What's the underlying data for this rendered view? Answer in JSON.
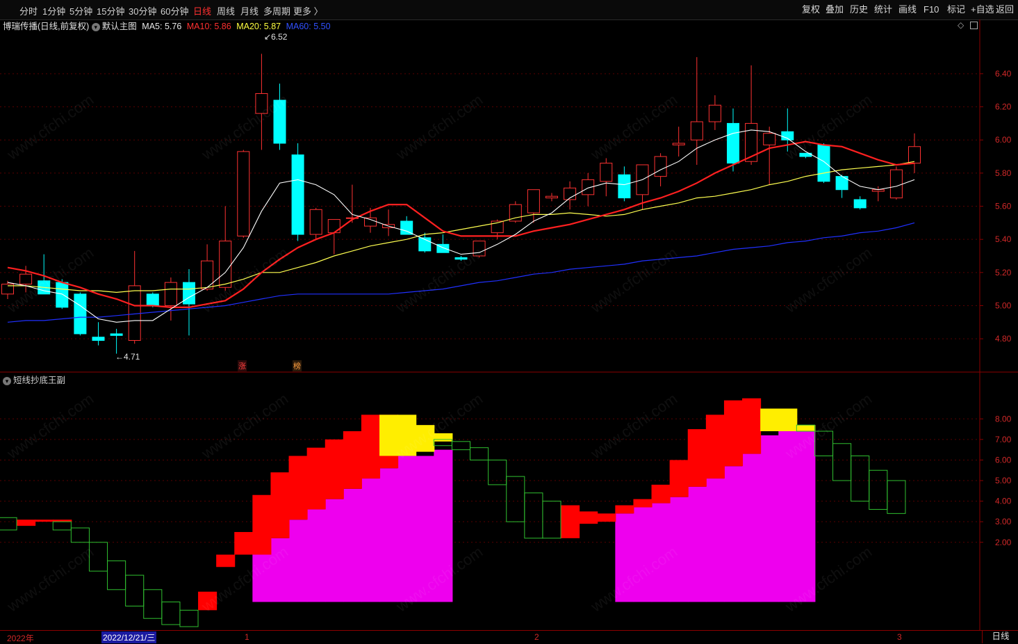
{
  "toolbar": {
    "periods": [
      "分时",
      "1分钟",
      "5分钟",
      "15分钟",
      "30分钟",
      "60分钟",
      "日线",
      "周线",
      "月线",
      "多周期",
      "更多 〉"
    ],
    "active_period": "日线",
    "buttons": [
      "复权",
      "叠加",
      "历史",
      "统计",
      "画线",
      "F10",
      "标记",
      "+自选",
      "返回"
    ]
  },
  "main_header": {
    "stock": "博瑞传播(日线,前复权)",
    "template": "默认主图",
    "ma5": "MA5: 5.76",
    "ma10": "MA10: 5.86",
    "ma20": "MA20: 5.87",
    "ma60": "MA60: 5.50"
  },
  "sub_header": {
    "title": "短线抄底王副"
  },
  "annotations": {
    "high": "6.52",
    "low": "4.71",
    "badge1": "涨",
    "badge2": "榜"
  },
  "date_axis": {
    "year": "2022年",
    "cursor": "2022/12/21/三",
    "m1": "1",
    "m2": "2",
    "m3": "3"
  },
  "period_label": "日线",
  "watermark": "www.cfchi.com",
  "colors": {
    "up": "#ff3232",
    "down": "#00ffff",
    "ma5": "#ffffff",
    "ma10": "#ff2020",
    "ma20": "#ffff50",
    "ma60": "#2030ff",
    "sub_green": "#30c030",
    "sub_red": "#ff0000",
    "sub_magenta": "#ee00ee",
    "sub_yellow": "#ffee00"
  },
  "chart_data": [
    {
      "type": "candlestick",
      "title": "博瑞传播(日线,前复权)",
      "y_ticks": [
        4.8,
        5.0,
        5.2,
        5.4,
        5.6,
        5.8,
        6.0,
        6.2,
        6.4
      ],
      "ylim": [
        4.62,
        6.66
      ],
      "candles": [
        {
          "o": 5.07,
          "h": 5.15,
          "l": 5.04,
          "c": 5.13
        },
        {
          "o": 5.13,
          "h": 5.24,
          "l": 5.08,
          "c": 5.19
        },
        {
          "o": 5.15,
          "h": 5.31,
          "l": 5.1,
          "c": 5.07
        },
        {
          "o": 5.14,
          "h": 5.16,
          "l": 4.98,
          "c": 4.99
        },
        {
          "o": 5.07,
          "h": 5.08,
          "l": 4.82,
          "c": 4.83
        },
        {
          "o": 4.81,
          "h": 4.9,
          "l": 4.76,
          "c": 4.79
        },
        {
          "o": 4.83,
          "h": 4.86,
          "l": 4.71,
          "c": 4.82
        },
        {
          "o": 4.79,
          "h": 5.33,
          "l": 4.77,
          "c": 5.12
        },
        {
          "o": 5.07,
          "h": 5.08,
          "l": 4.99,
          "c": 5.0
        },
        {
          "o": 5.0,
          "h": 5.17,
          "l": 4.91,
          "c": 5.14
        },
        {
          "o": 5.14,
          "h": 5.22,
          "l": 4.82,
          "c": 5.01
        },
        {
          "o": 5.1,
          "h": 5.37,
          "l": 5.09,
          "c": 5.27
        },
        {
          "o": 5.11,
          "h": 5.6,
          "l": 5.09,
          "c": 5.39
        },
        {
          "o": 5.42,
          "h": 5.94,
          "l": 5.41,
          "c": 5.93
        },
        {
          "o": 6.16,
          "h": 6.52,
          "l": 5.94,
          "c": 6.28
        },
        {
          "o": 6.24,
          "h": 6.34,
          "l": 5.94,
          "c": 5.98
        },
        {
          "o": 5.91,
          "h": 5.98,
          "l": 5.39,
          "c": 5.43
        },
        {
          "o": 5.43,
          "h": 5.59,
          "l": 5.4,
          "c": 5.58
        },
        {
          "o": 5.44,
          "h": 5.52,
          "l": 5.31,
          "c": 5.52
        },
        {
          "o": 5.53,
          "h": 5.73,
          "l": 5.5,
          "c": 5.53
        },
        {
          "o": 5.48,
          "h": 5.59,
          "l": 5.44,
          "c": 5.53
        },
        {
          "o": 5.47,
          "h": 5.58,
          "l": 5.42,
          "c": 5.49
        },
        {
          "o": 5.51,
          "h": 5.54,
          "l": 5.43,
          "c": 5.43
        },
        {
          "o": 5.41,
          "h": 5.44,
          "l": 5.32,
          "c": 5.33
        },
        {
          "o": 5.37,
          "h": 5.43,
          "l": 5.32,
          "c": 5.32
        },
        {
          "o": 5.29,
          "h": 5.3,
          "l": 5.27,
          "c": 5.28
        },
        {
          "o": 5.3,
          "h": 5.39,
          "l": 5.29,
          "c": 5.39
        },
        {
          "o": 5.44,
          "h": 5.52,
          "l": 5.4,
          "c": 5.51
        },
        {
          "o": 5.51,
          "h": 5.63,
          "l": 5.5,
          "c": 5.61
        },
        {
          "o": 5.56,
          "h": 5.7,
          "l": 5.5,
          "c": 5.7
        },
        {
          "o": 5.65,
          "h": 5.68,
          "l": 5.63,
          "c": 5.66
        },
        {
          "o": 5.64,
          "h": 5.75,
          "l": 5.58,
          "c": 5.71
        },
        {
          "o": 5.67,
          "h": 5.8,
          "l": 5.6,
          "c": 5.76
        },
        {
          "o": 5.75,
          "h": 5.89,
          "l": 5.66,
          "c": 5.86
        },
        {
          "o": 5.79,
          "h": 5.84,
          "l": 5.63,
          "c": 5.65
        },
        {
          "o": 5.67,
          "h": 5.85,
          "l": 5.58,
          "c": 5.85
        },
        {
          "o": 5.78,
          "h": 5.92,
          "l": 5.72,
          "c": 5.9
        },
        {
          "o": 5.97,
          "h": 6.08,
          "l": 5.9,
          "c": 5.98
        },
        {
          "o": 6.0,
          "h": 6.5,
          "l": 5.85,
          "c": 6.11
        },
        {
          "o": 6.11,
          "h": 6.27,
          "l": 6.06,
          "c": 6.21
        },
        {
          "o": 6.1,
          "h": 6.19,
          "l": 5.81,
          "c": 5.86
        },
        {
          "o": 5.87,
          "h": 6.45,
          "l": 5.85,
          "c": 6.1
        },
        {
          "o": 5.97,
          "h": 6.08,
          "l": 5.73,
          "c": 6.04
        },
        {
          "o": 6.05,
          "h": 6.19,
          "l": 5.93,
          "c": 6.0
        },
        {
          "o": 5.92,
          "h": 5.92,
          "l": 5.89,
          "c": 5.9
        },
        {
          "o": 5.97,
          "h": 5.98,
          "l": 5.74,
          "c": 5.75
        },
        {
          "o": 5.78,
          "h": 5.79,
          "l": 5.65,
          "c": 5.7
        },
        {
          "o": 5.64,
          "h": 5.66,
          "l": 5.58,
          "c": 5.59
        },
        {
          "o": 5.69,
          "h": 5.72,
          "l": 5.63,
          "c": 5.7
        },
        {
          "o": 5.65,
          "h": 5.84,
          "l": 5.64,
          "c": 5.82
        },
        {
          "o": 5.86,
          "h": 6.04,
          "l": 5.8,
          "c": 5.96
        }
      ],
      "ma5": [
        5.14,
        5.12,
        5.09,
        5.07,
        5.0,
        4.92,
        4.9,
        4.91,
        4.91,
        4.98,
        5.05,
        5.11,
        5.2,
        5.35,
        5.57,
        5.74,
        5.76,
        5.73,
        5.67,
        5.55,
        5.52,
        5.48,
        5.45,
        5.4,
        5.35,
        5.31,
        5.32,
        5.37,
        5.43,
        5.51,
        5.56,
        5.65,
        5.71,
        5.74,
        5.73,
        5.76,
        5.82,
        5.87,
        5.95,
        6.0,
        6.04,
        6.06,
        6.05,
        6.01,
        5.93,
        5.87,
        5.78,
        5.72,
        5.7,
        5.72,
        5.76
      ],
      "ma10": [
        5.23,
        5.21,
        5.18,
        5.14,
        5.11,
        5.07,
        5.04,
        5.0,
        5.0,
        4.99,
        4.99,
        5.01,
        5.03,
        5.1,
        5.2,
        5.28,
        5.35,
        5.4,
        5.44,
        5.52,
        5.57,
        5.61,
        5.61,
        5.53,
        5.45,
        5.42,
        5.42,
        5.42,
        5.42,
        5.45,
        5.47,
        5.49,
        5.52,
        5.55,
        5.58,
        5.62,
        5.65,
        5.69,
        5.74,
        5.8,
        5.85,
        5.9,
        5.95,
        5.97,
        5.99,
        5.97,
        5.96,
        5.92,
        5.88,
        5.85,
        5.86
      ],
      "ma20": [
        5.12,
        5.12,
        5.11,
        5.1,
        5.09,
        5.09,
        5.08,
        5.09,
        5.09,
        5.1,
        5.1,
        5.11,
        5.13,
        5.16,
        5.2,
        5.2,
        5.23,
        5.26,
        5.3,
        5.33,
        5.36,
        5.38,
        5.4,
        5.43,
        5.44,
        5.46,
        5.48,
        5.5,
        5.53,
        5.55,
        5.55,
        5.56,
        5.55,
        5.54,
        5.55,
        5.58,
        5.6,
        5.62,
        5.65,
        5.66,
        5.68,
        5.7,
        5.73,
        5.75,
        5.78,
        5.8,
        5.82,
        5.83,
        5.84,
        5.85,
        5.87
      ],
      "ma60": [
        4.9,
        4.91,
        4.91,
        4.92,
        4.93,
        4.93,
        4.94,
        4.95,
        4.96,
        4.97,
        4.98,
        4.99,
        5.0,
        5.02,
        5.04,
        5.06,
        5.07,
        5.07,
        5.07,
        5.07,
        5.07,
        5.07,
        5.08,
        5.09,
        5.1,
        5.12,
        5.14,
        5.15,
        5.17,
        5.19,
        5.2,
        5.22,
        5.23,
        5.24,
        5.25,
        5.27,
        5.28,
        5.29,
        5.3,
        5.32,
        5.34,
        5.35,
        5.36,
        5.38,
        5.39,
        5.41,
        5.42,
        5.44,
        5.45,
        5.47,
        5.5
      ]
    },
    {
      "type": "indicator-bars",
      "title": "短线抄底王副",
      "y_ticks": [
        2.0,
        3.0,
        4.0,
        5.0,
        6.0,
        7.0,
        8.0
      ],
      "ylim": [
        -2.2,
        9.7
      ],
      "green_boxes": [
        {
          "i": 0,
          "top": 3.2,
          "bot": 2.6
        },
        {
          "i": 3,
          "top": 3.0,
          "bot": 2.6
        },
        {
          "i": 4,
          "top": 2.7,
          "bot": 2.0
        },
        {
          "i": 5,
          "top": 2.0,
          "bot": 0.6
        },
        {
          "i": 6,
          "top": 1.1,
          "bot": -0.3
        },
        {
          "i": 7,
          "top": 0.4,
          "bot": -1.1
        },
        {
          "i": 8,
          "top": -0.3,
          "bot": -1.7
        },
        {
          "i": 9,
          "top": -0.9,
          "bot": -2.0
        },
        {
          "i": 10,
          "top": -1.3,
          "bot": -2.1
        },
        {
          "i": 24,
          "top": 7.0,
          "bot": 6.7
        },
        {
          "i": 25,
          "top": 6.9,
          "bot": 6.5
        },
        {
          "i": 26,
          "top": 6.6,
          "bot": 6.0
        },
        {
          "i": 27,
          "top": 6.0,
          "bot": 4.8
        },
        {
          "i": 28,
          "top": 5.2,
          "bot": 3.0
        },
        {
          "i": 29,
          "top": 4.4,
          "bot": 2.2
        },
        {
          "i": 30,
          "top": 4.0,
          "bot": 2.2
        },
        {
          "i": 44,
          "top": 7.7,
          "bot": 7.4
        },
        {
          "i": 45,
          "top": 7.4,
          "bot": 6.2
        },
        {
          "i": 46,
          "top": 6.8,
          "bot": 5.0
        },
        {
          "i": 47,
          "top": 6.2,
          "bot": 4.0
        },
        {
          "i": 48,
          "top": 5.5,
          "bot": 3.6
        },
        {
          "i": 49,
          "top": 5.0,
          "bot": 3.4
        }
      ],
      "red_boxes": [
        {
          "i": 1,
          "top": 3.1,
          "bot": 2.8
        },
        {
          "i": 2,
          "top": 3.1,
          "bot": 3.0
        },
        {
          "i": 3,
          "top": 3.1,
          "bot": 3.0
        },
        {
          "i": 11,
          "top": -0.4,
          "bot": -1.3
        },
        {
          "i": 12,
          "top": 1.4,
          "bot": 0.8
        },
        {
          "i": 13,
          "top": 2.5,
          "bot": 1.4
        },
        {
          "i": 14,
          "top": 4.3,
          "bot": 1.4
        },
        {
          "i": 15,
          "top": 5.4,
          "bot": 2.2
        },
        {
          "i": 16,
          "top": 6.2,
          "bot": 3.1
        },
        {
          "i": 17,
          "top": 6.6,
          "bot": 3.6
        },
        {
          "i": 18,
          "top": 7.0,
          "bot": 4.1
        },
        {
          "i": 19,
          "top": 7.4,
          "bot": 4.6
        },
        {
          "i": 20,
          "top": 8.2,
          "bot": 5.1
        },
        {
          "i": 21,
          "top": 8.2,
          "bot": 5.6
        },
        {
          "i": 31,
          "top": 3.8,
          "bot": 2.2
        },
        {
          "i": 32,
          "top": 3.5,
          "bot": 2.9
        },
        {
          "i": 33,
          "top": 3.4,
          "bot": 3.0
        },
        {
          "i": 34,
          "top": 3.8,
          "bot": 3.4
        },
        {
          "i": 35,
          "top": 4.1,
          "bot": 3.7
        },
        {
          "i": 36,
          "top": 4.8,
          "bot": 3.9
        },
        {
          "i": 37,
          "top": 6.0,
          "bot": 4.2
        },
        {
          "i": 38,
          "top": 7.5,
          "bot": 4.7
        },
        {
          "i": 39,
          "top": 8.2,
          "bot": 5.1
        },
        {
          "i": 40,
          "top": 8.9,
          "bot": 5.7
        },
        {
          "i": 41,
          "top": 9.0,
          "bot": 6.3
        }
      ],
      "magenta": [
        {
          "i": 14,
          "top": 1.4
        },
        {
          "i": 15,
          "top": 2.2
        },
        {
          "i": 16,
          "top": 3.1
        },
        {
          "i": 17,
          "top": 3.6
        },
        {
          "i": 18,
          "top": 4.1
        },
        {
          "i": 19,
          "top": 4.6
        },
        {
          "i": 20,
          "top": 5.1
        },
        {
          "i": 21,
          "top": 5.6
        },
        {
          "i": 22,
          "top": 6.2
        },
        {
          "i": 23,
          "top": 6.2
        },
        {
          "i": 24,
          "top": 6.5
        },
        {
          "i": 34,
          "top": 3.4
        },
        {
          "i": 35,
          "top": 3.7
        },
        {
          "i": 36,
          "top": 3.9
        },
        {
          "i": 37,
          "top": 4.2
        },
        {
          "i": 38,
          "top": 4.7
        },
        {
          "i": 39,
          "top": 5.1
        },
        {
          "i": 40,
          "top": 5.7
        },
        {
          "i": 41,
          "top": 6.3
        },
        {
          "i": 42,
          "top": 7.2
        },
        {
          "i": 43,
          "top": 7.4
        },
        {
          "i": 44,
          "top": 7.4
        }
      ],
      "magenta_base": -0.9,
      "yellow_boxes": [
        {
          "i": 21,
          "top": 8.2,
          "bot": 6.2
        },
        {
          "i": 22,
          "top": 8.2,
          "bot": 6.2
        },
        {
          "i": 23,
          "top": 7.7,
          "bot": 6.4
        },
        {
          "i": 24,
          "top": 7.3,
          "bot": 6.9
        },
        {
          "i": 42,
          "top": 8.5,
          "bot": 7.4
        },
        {
          "i": 43,
          "top": 8.5,
          "bot": 7.4
        },
        {
          "i": 44,
          "top": 7.7,
          "bot": 7.4
        }
      ]
    }
  ]
}
